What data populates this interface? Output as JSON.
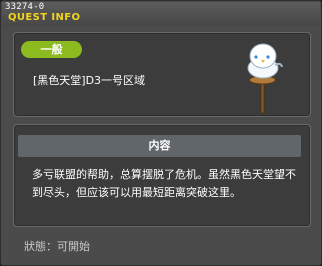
{
  "window": {
    "id": "33274-0",
    "title": "QUEST INFO"
  },
  "quest": {
    "category_badge": "一般",
    "name": "[黑色天堂]D3一号区域",
    "npc_icon": "snowman-on-signpost-icon"
  },
  "content": {
    "header": "内容",
    "description": "多亏联盟的帮助，总算摆脱了危机。虽然黑色天堂望不到尽头，但应该可以用最短距离突破这里。"
  },
  "status": {
    "text": "狀態：可開始"
  },
  "colors": {
    "title": "#f2d41e",
    "badge": "#8cbb20",
    "header": "#60666a",
    "window_bg": "#4b4b4b",
    "panel_bg": "#3c3c3c"
  }
}
